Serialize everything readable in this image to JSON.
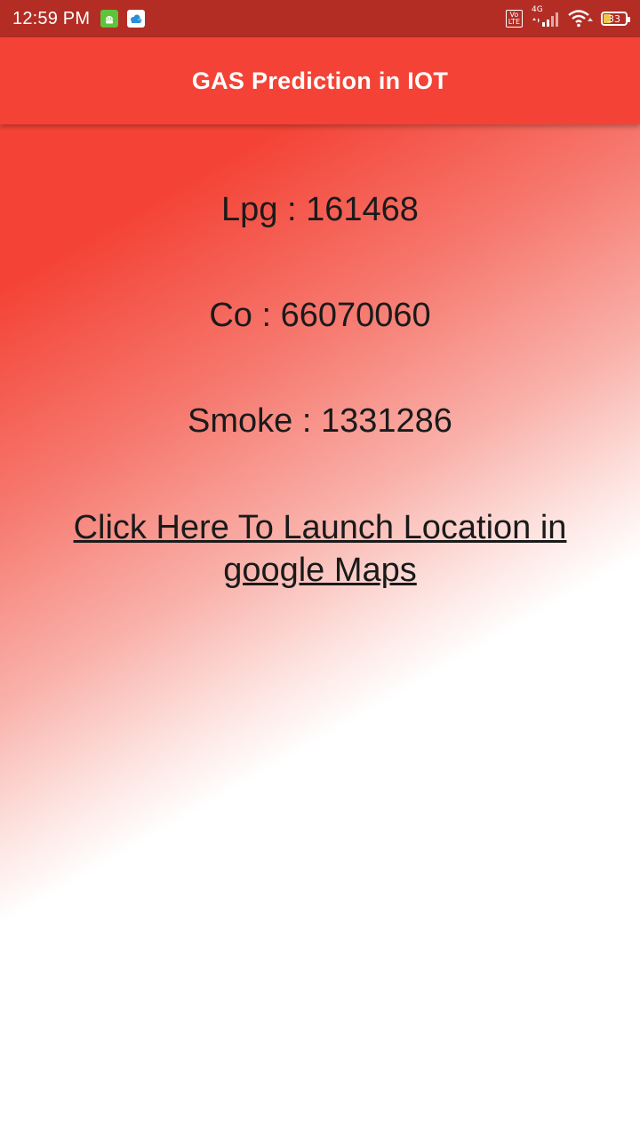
{
  "status_bar": {
    "time": "12:59 PM",
    "network_label": "4G",
    "volte_line1": "Vo",
    "volte_line2": "LTE",
    "battery_level": "33",
    "battery_fraction": 0.33,
    "icons": [
      "android-notification-icon",
      "cloud-notification-icon",
      "volte-icon",
      "signal-icon",
      "wifi-icon",
      "battery-icon"
    ]
  },
  "app_bar": {
    "title": "GAS Prediction in IOT",
    "color": "#f44336"
  },
  "readings": {
    "lpg": "Lpg : 161468",
    "co": "Co : 66070060",
    "smoke": "Smoke : 1331286"
  },
  "maps_link": {
    "label": "Click Here To Launch Location in google Maps"
  },
  "colors": {
    "status_bar": "#b32d25",
    "accent": "#f44336"
  }
}
